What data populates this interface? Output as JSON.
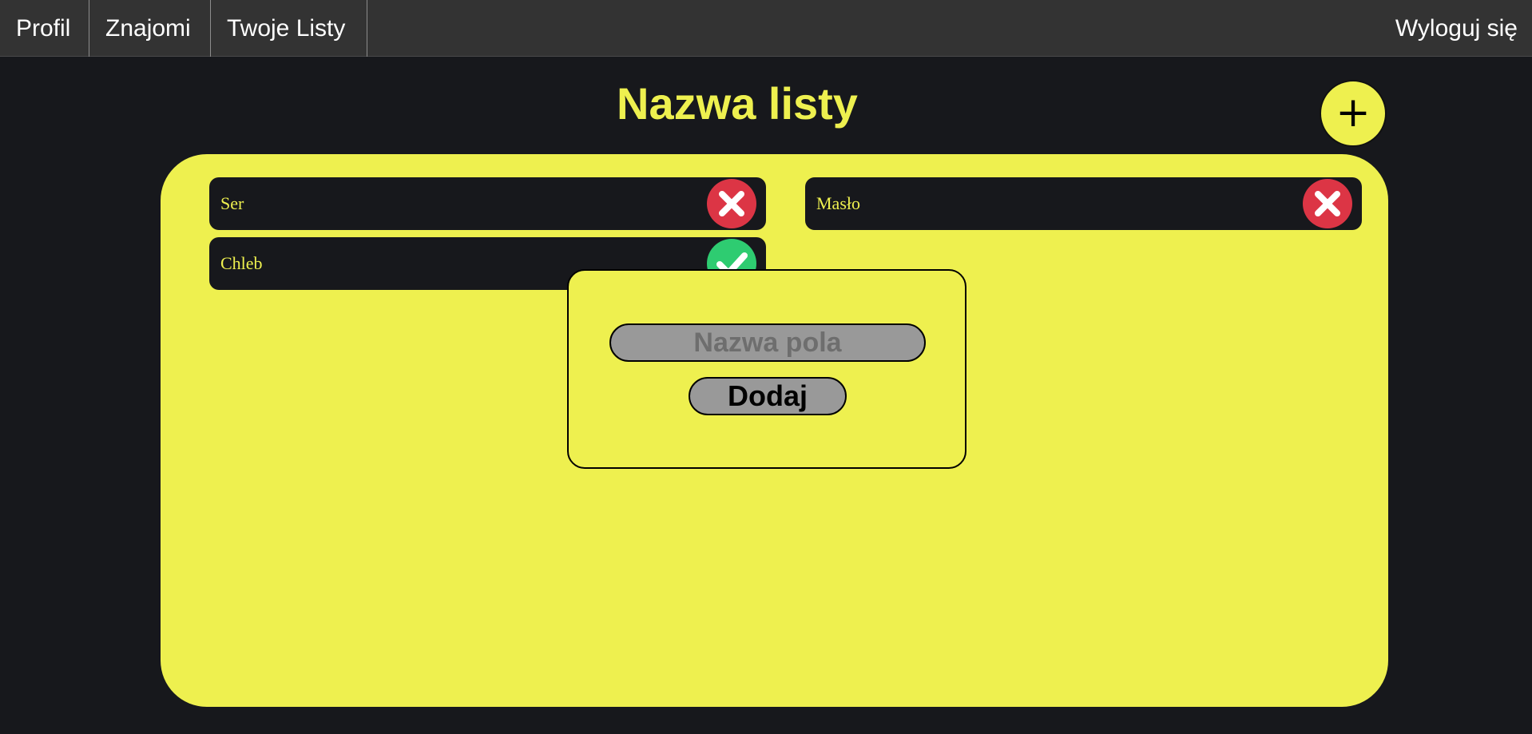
{
  "nav": {
    "items": [
      {
        "label": "Profil"
      },
      {
        "label": "Znajomi"
      },
      {
        "label": "Twoje Listy"
      }
    ],
    "logout_label": "Wyloguj się"
  },
  "page": {
    "title": "Nazwa listy",
    "add_symbol": "+"
  },
  "list": {
    "items": [
      {
        "label": "Ser",
        "status": "remove",
        "status_icon": "x-icon",
        "status_color": "#dc3545"
      },
      {
        "label": "Masło",
        "status": "remove",
        "status_icon": "x-icon",
        "status_color": "#dc3545"
      },
      {
        "label": "Chleb",
        "status": "done",
        "status_icon": "check-icon",
        "status_color": "#2ecc71"
      }
    ]
  },
  "modal": {
    "input_placeholder": "Nazwa pola",
    "input_value": "",
    "submit_label": "Dodaj"
  },
  "colors": {
    "background": "#17181c",
    "accent": "#eef04f",
    "nav_bg": "#333333",
    "danger": "#dc3545",
    "success": "#2ecc71",
    "input_bg": "#999999"
  }
}
